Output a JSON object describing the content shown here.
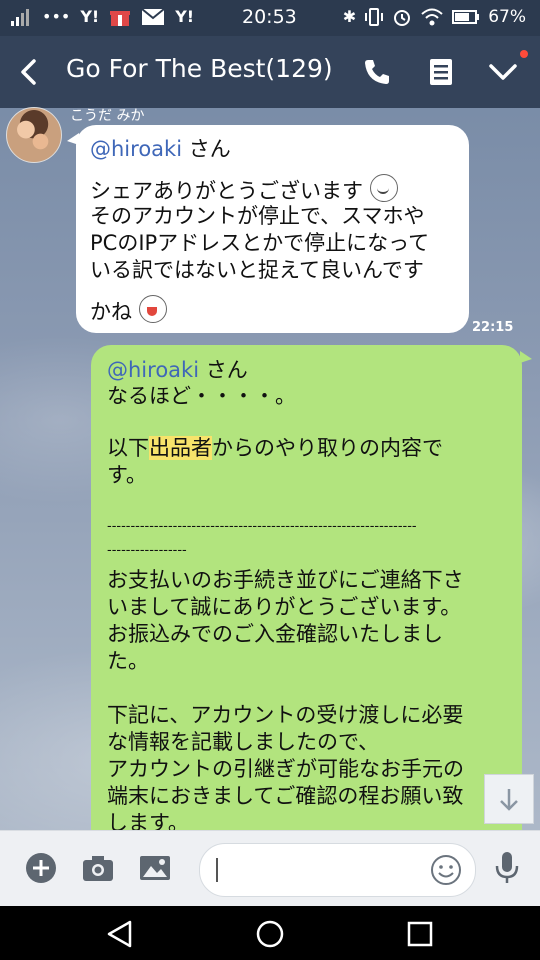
{
  "status_bar": {
    "carrier_icons": [
      "signal-icon",
      "dots-icon",
      "yahoo-icon",
      "gift-icon",
      "mail-icon",
      "yahoo-icon"
    ],
    "time": "20:53",
    "battery": "67%"
  },
  "header": {
    "title": "Go For The Best(129)"
  },
  "messages": {
    "incoming": {
      "sender": "こうだ みか",
      "mention": "@hiroaki",
      "mention_suffix": " さん",
      "line1": "シェアありがとうございます",
      "body": "そのアカウントが停止で、スマホや\nPCのIPアドレスとかで停止になって\nいる訳ではないと捉えて良いんです",
      "last": "かね",
      "time": "22:15"
    },
    "outgoing": {
      "mention": "@hiroaki",
      "mention_suffix": " さん",
      "line1": "なるほど・・・・。",
      "line2_pre": "以下",
      "line2_highlight": "出品者",
      "line2_post": "からのやり取りの内容で\nす。",
      "divider": "------------------------------------------------------------------\n-----------------",
      "body": "お支払いのお手続き並びにご連絡下さ\nいまして誠にありがとうございます。\nお振込みでのご入金確認いたしまし\nた。\n\n下記に、アカウントの受け渡しに必要\nな情報を記載しましたので、\nアカウントの引継ぎが可能なお手元の\n端末におきましてご確認の程お願い致\nします。"
    }
  },
  "colors": {
    "header_bg": "#34435a",
    "incoming_bubble": "#ffffff",
    "outgoing_bubble": "#b2e47e",
    "mention": "#3f67b8",
    "highlight": "#f7e36b"
  }
}
